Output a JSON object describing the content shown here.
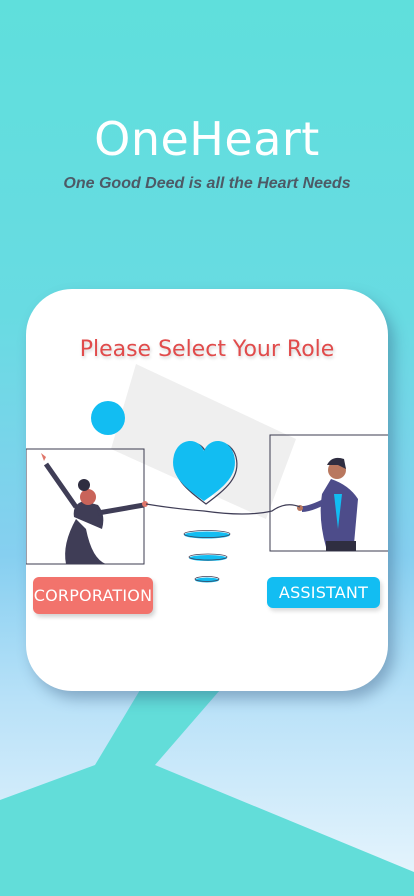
{
  "app": {
    "title": "OneHeart",
    "tagline": "One Good Deed is all the Heart Needs"
  },
  "role_card": {
    "heading": "Please Select Your Role",
    "illustration": "two-people-heart-connection",
    "buttons": [
      {
        "label": "CORPORATION",
        "color": "#f2736c"
      },
      {
        "label": "ASSISTANT",
        "color": "#12bdf2"
      }
    ]
  },
  "colors": {
    "accent_red": "#e14b4b",
    "accent_blue": "#12bdf2",
    "background_teal": "#5fdfdc"
  }
}
